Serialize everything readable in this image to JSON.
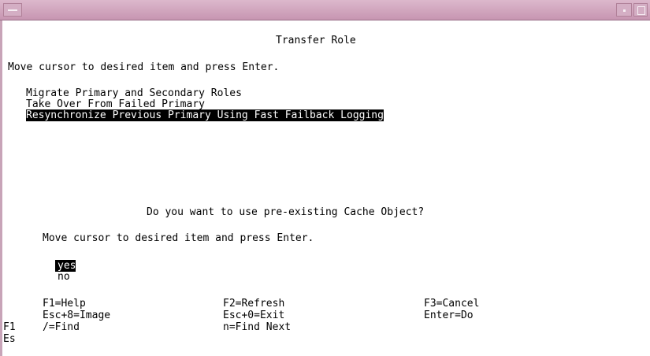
{
  "window": {
    "menu_icon": "window-menu-icon",
    "minimize_icon": "minimize-icon",
    "maximize_icon": "maximize-icon"
  },
  "screen": {
    "title": "Transfer Role",
    "instruction": "Move cursor to desired item and press Enter.",
    "menu_items": [
      "Migrate Primary and Secondary Roles",
      "Take Over From Failed Primary",
      "Resynchronize Previous Primary Using Fast Failback Logging"
    ],
    "selected_menu_index": 2,
    "left_fragments": [
      "F1",
      "Es"
    ]
  },
  "dialog": {
    "question": "Do you want to use pre-existing Cache Object?",
    "instruction": "Move cursor to desired item and press Enter.",
    "options": [
      "yes",
      "no"
    ],
    "selected_option_index": 0,
    "keys": [
      [
        "F1=Help",
        "F2=Refresh",
        "F3=Cancel"
      ],
      [
        "Esc+8=Image",
        "Esc+0=Exit",
        "Enter=Do"
      ],
      [
        "/=Find",
        "n=Find Next",
        ""
      ]
    ]
  }
}
